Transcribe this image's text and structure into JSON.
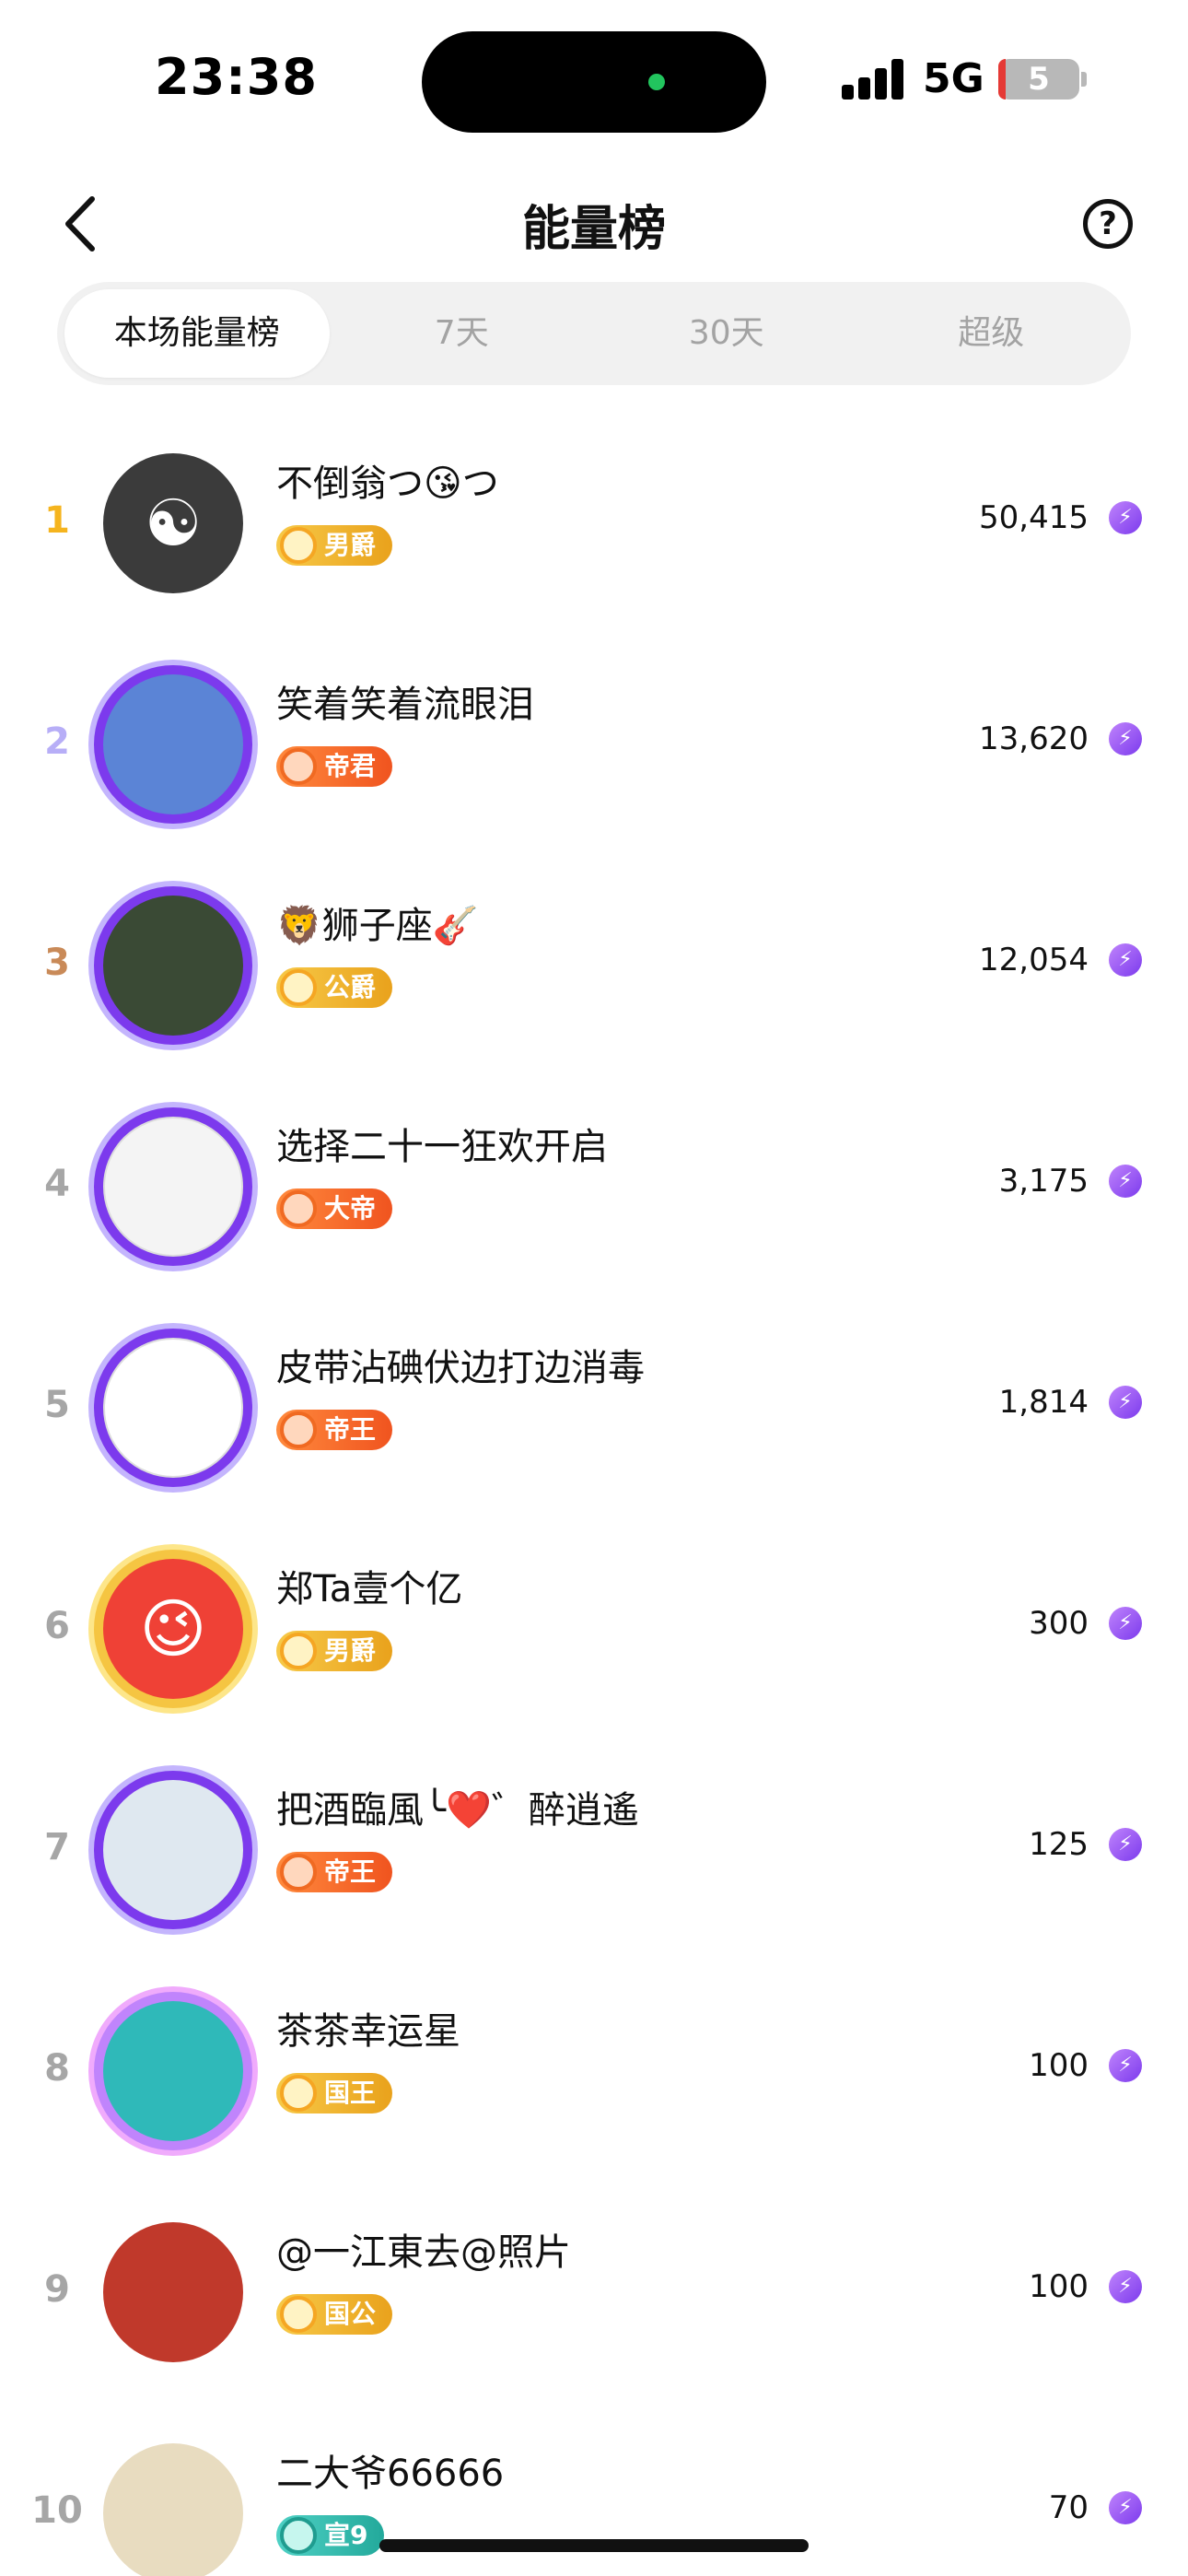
{
  "status_bar": {
    "time": "23:38",
    "network": "5G",
    "battery": "5"
  },
  "header": {
    "title": "能量榜",
    "help_icon": "question-circle-icon",
    "back_icon": "chevron-left-icon"
  },
  "tabs": [
    {
      "label": "本场能量榜",
      "active": true
    },
    {
      "label": "7天",
      "active": false
    },
    {
      "label": "30天",
      "active": false
    },
    {
      "label": "超级",
      "active": false
    }
  ],
  "rank_colors": {
    "1": "#f5b41e",
    "2": "#b7aef7",
    "3": "#c98a58",
    "default": "#a6a6a6"
  },
  "rows": [
    {
      "rank": "1",
      "name": "不倒翁つ😘つ",
      "badge": "男爵",
      "badge_style": "gold",
      "score": "50,415",
      "avatar_color": "#3b3b3b",
      "avatar_glyph": "☯",
      "frame": "none"
    },
    {
      "rank": "2",
      "name": "笑着笑着流眼泪",
      "badge": "帝君",
      "badge_style": "orange",
      "score": "13,620",
      "avatar_color": "#5b84d6",
      "avatar_glyph": "",
      "frame": "purple"
    },
    {
      "rank": "3",
      "name": "🦁狮子座🎸",
      "badge": "公爵",
      "badge_style": "gold",
      "score": "12,054",
      "avatar_color": "#3a4a35",
      "avatar_glyph": "",
      "frame": "purple"
    },
    {
      "rank": "4",
      "name": "选择二十一狂欢开启",
      "badge": "大帝",
      "badge_style": "orange",
      "score": "3,175",
      "avatar_color": "#f4f4f4",
      "avatar_glyph": "",
      "frame": "purple"
    },
    {
      "rank": "5",
      "name": "皮带沾碘伏边打边消毒",
      "badge": "帝王",
      "badge_style": "orange",
      "score": "1,814",
      "avatar_color": "#ffffff",
      "avatar_glyph": "",
      "frame": "purple"
    },
    {
      "rank": "6",
      "name": "郑Ta壹个亿",
      "badge": "男爵",
      "badge_style": "gold",
      "score": "300",
      "avatar_color": "#ef4136",
      "avatar_glyph": "😉",
      "frame": "gold"
    },
    {
      "rank": "7",
      "name": "把酒臨風╰❤️゛醉逍遙",
      "badge": "帝王",
      "badge_style": "orange",
      "score": "125",
      "avatar_color": "#dfe8f0",
      "avatar_glyph": "",
      "frame": "purple"
    },
    {
      "rank": "8",
      "name": "茶茶幸运星",
      "badge": "国王",
      "badge_style": "gold",
      "score": "100",
      "avatar_color": "#2fb9b9",
      "avatar_glyph": "",
      "frame": "pink"
    },
    {
      "rank": "9",
      "name": "@一江東去@照片",
      "badge": "国公",
      "badge_style": "gold",
      "score": "100",
      "avatar_color": "#c0392b",
      "avatar_glyph": "",
      "frame": "none"
    },
    {
      "rank": "10",
      "name": "二大爷66666",
      "badge": "宣9",
      "badge_style": "teal",
      "score": "70",
      "avatar_color": "#e8dcc0",
      "avatar_glyph": "",
      "frame": "none"
    }
  ]
}
